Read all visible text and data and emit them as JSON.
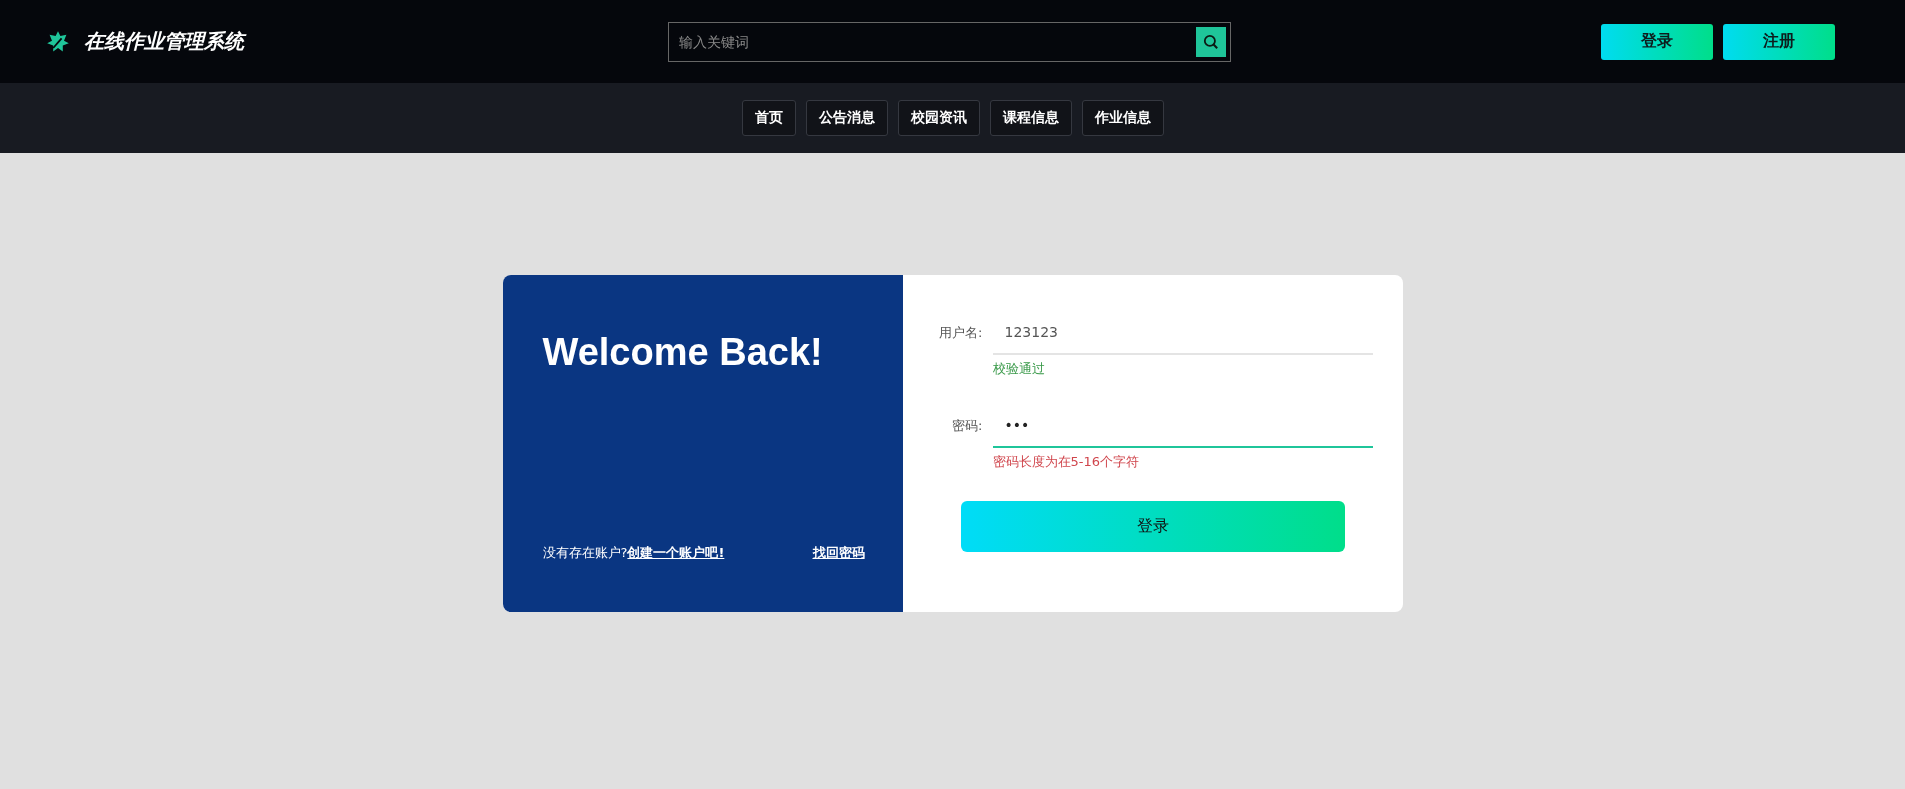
{
  "header": {
    "logo_text": "在线作业管理系统",
    "search": {
      "placeholder": "输入关键词"
    },
    "buttons": [
      "登录",
      "注册"
    ]
  },
  "nav": [
    {
      "label": "首页",
      "selected": false
    },
    {
      "label": "公告消息",
      "selected": false
    },
    {
      "label": "校园资讯",
      "selected": false
    },
    {
      "label": "课程信息",
      "selected": false
    },
    {
      "label": "作业信息",
      "selected": false
    }
  ],
  "welcome": {
    "title": "Welcome Back!",
    "prompt": "没有存在账户?",
    "register_link": "创建一个账户吧!",
    "forgot_link": "找回密码"
  },
  "form": {
    "fields": [
      {
        "label": "用户名:",
        "value": "123123",
        "focused": false,
        "message": "校验通过",
        "valid": true
      },
      {
        "label": "密码:",
        "value": "•••",
        "focused": true,
        "message": "密码长度为在5-16个字符",
        "valid": false
      }
    ],
    "submit": "登录"
  }
}
